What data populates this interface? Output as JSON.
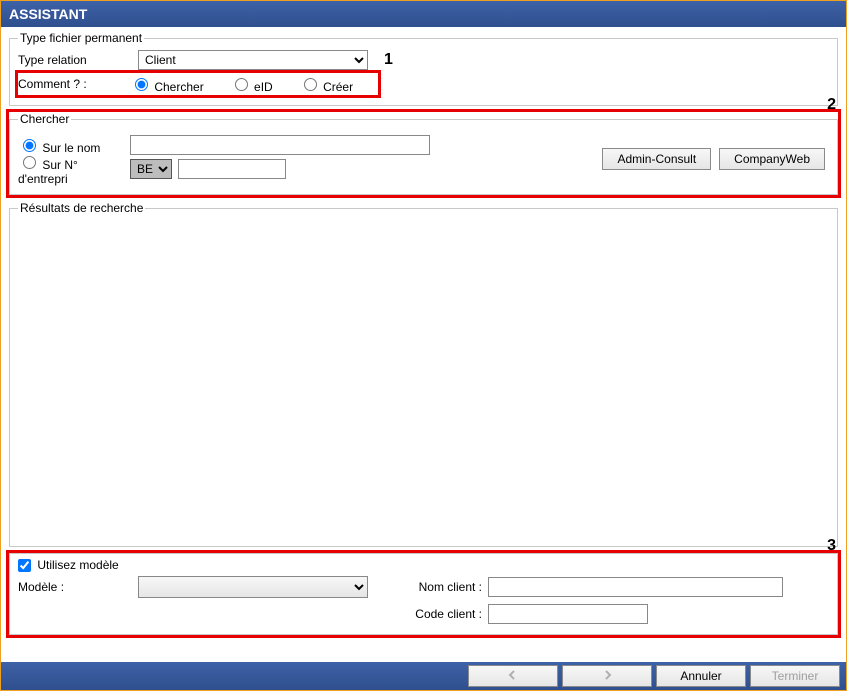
{
  "header": {
    "title": "ASSISTANT"
  },
  "permanent": {
    "legend": "Type fichier permanent",
    "type_relation_label": "Type relation",
    "type_relation_value": "Client",
    "comment_label": "Comment ? :",
    "radios": {
      "chercher": "Chercher",
      "eid": "eID",
      "creer": "Créer"
    }
  },
  "annotations": {
    "one": "1",
    "two": "2",
    "three": "3"
  },
  "chercher": {
    "legend": "Chercher",
    "sur_le_nom": "Sur le nom",
    "sur_num": "Sur N° d'entrepri",
    "country_value": "BE",
    "btn_admin": "Admin-Consult",
    "btn_company": "CompanyWeb"
  },
  "results": {
    "legend": "Résultats de recherche"
  },
  "model": {
    "use_checkbox": "Utilisez modèle",
    "modele_label": "Modèle :",
    "nom_client_label": "Nom client :",
    "code_client_label": "Code client :"
  },
  "footer": {
    "annuler": "Annuler",
    "terminer": "Terminer"
  }
}
